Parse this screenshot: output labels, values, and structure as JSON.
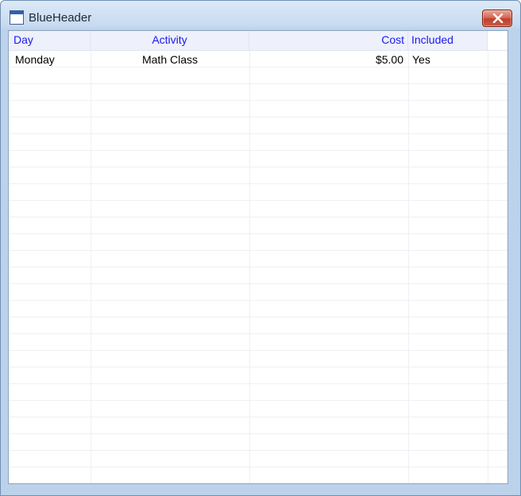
{
  "window": {
    "title": "BlueHeader",
    "icons": {
      "app": "window-icon",
      "close": "close-icon"
    }
  },
  "table": {
    "columns": [
      "Day",
      "Activity",
      "Cost",
      "Included"
    ],
    "rows": [
      [
        "Monday",
        "Math Class",
        "$5.00",
        "Yes"
      ]
    ]
  },
  "colors": {
    "header_text": "#1a1aee",
    "header_background": "#eef0fb",
    "close_button": "#c0402d"
  }
}
